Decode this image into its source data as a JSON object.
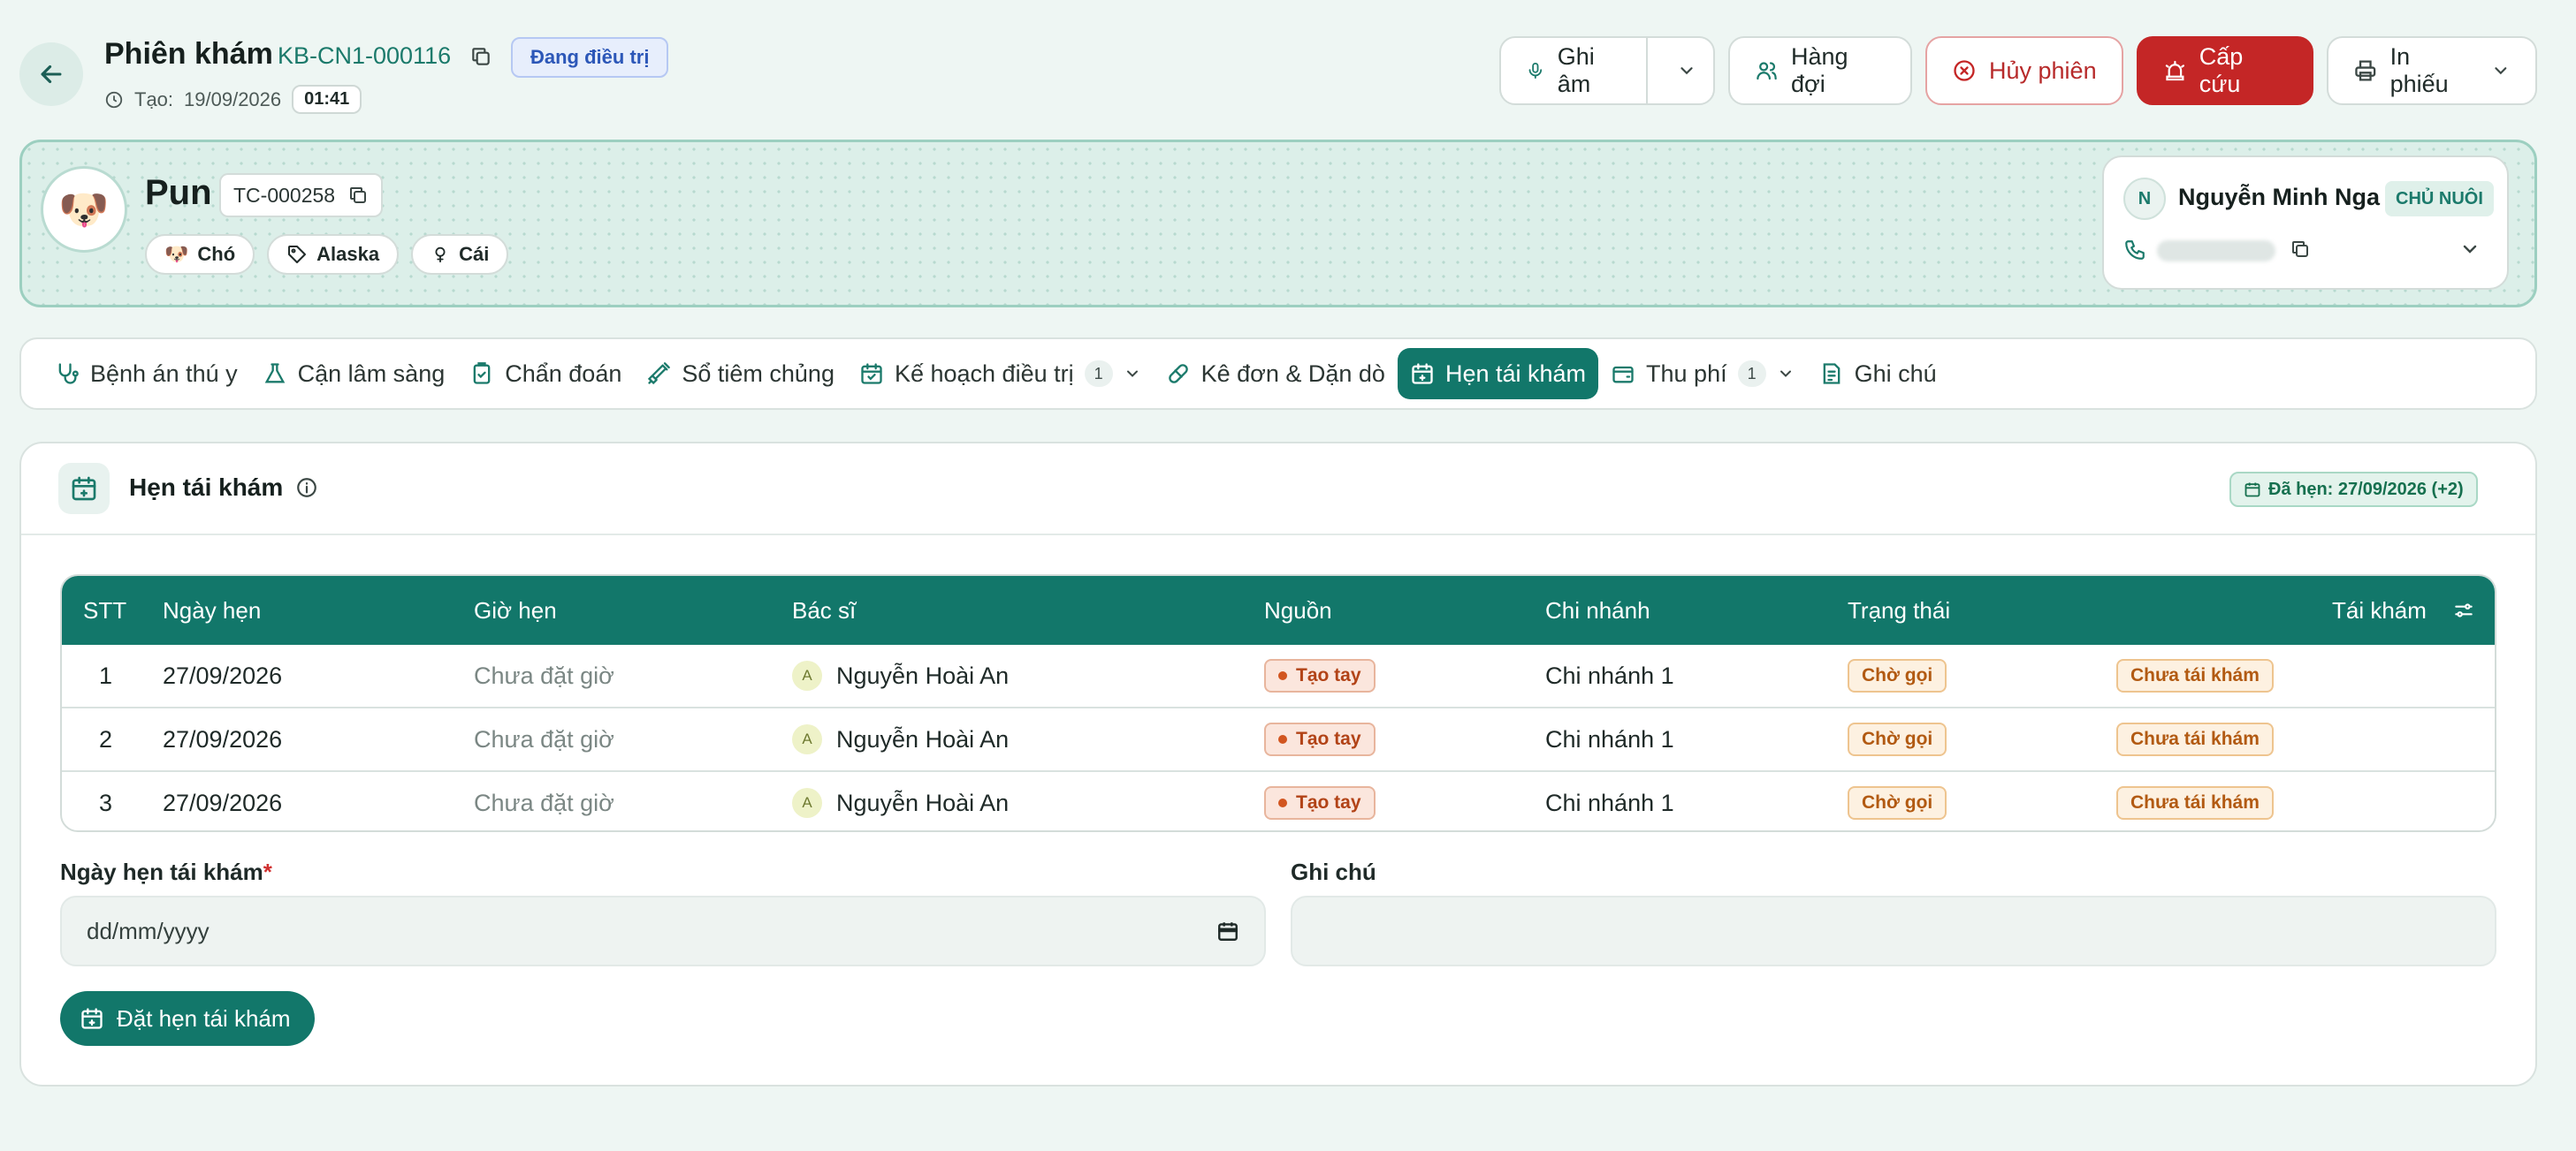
{
  "header": {
    "title": "Phiên khám",
    "session_code": "KB-CN1-000116",
    "status": "Đang điều trị",
    "created_label": "Tạo:",
    "created_date": "19/09/2026",
    "elapsed_time": "01:41",
    "buttons": {
      "record": "Ghi âm",
      "queue": "Hàng đợi",
      "cancel": "Hủy phiên",
      "emergency": "Cấp cứu",
      "print": "In phiếu"
    }
  },
  "patient": {
    "avatar_emoji": "🐶",
    "name": "Pun",
    "code": "TC-000258",
    "species": "Chó",
    "breed": "Alaska",
    "sex": "Cái",
    "owner": {
      "initial": "N",
      "name": "Nguyễn Minh Nga",
      "role": "CHỦ NUÔI"
    }
  },
  "tabs": [
    {
      "label": "Bệnh án thú y",
      "icon": "stethoscope-icon"
    },
    {
      "label": "Cận lâm sàng",
      "icon": "flask-icon"
    },
    {
      "label": "Chẩn đoán",
      "icon": "clipboard-icon"
    },
    {
      "label": "Sổ tiêm chủng",
      "icon": "syringe-icon"
    },
    {
      "label": "Kế hoạch điều trị",
      "icon": "calendar-check-icon",
      "count": "1"
    },
    {
      "label": "Kê đơn & Dặn dò",
      "icon": "pill-icon"
    },
    {
      "label": "Hẹn tái khám",
      "icon": "calendar-icon",
      "active": true
    },
    {
      "label": "Thu phí",
      "icon": "wallet-icon",
      "count": "1"
    },
    {
      "label": "Ghi chú",
      "icon": "note-icon"
    }
  ],
  "section": {
    "title": "Hẹn tái khám",
    "booked_badge": "Đã hẹn: 27/09/2026 (+2)"
  },
  "table": {
    "columns": [
      "STT",
      "Ngày hẹn",
      "Giờ hẹn",
      "Bác sĩ",
      "Nguồn",
      "Chi nhánh",
      "Trạng thái",
      "Tái khám"
    ],
    "rows": [
      {
        "stt": "1",
        "date": "27/09/2026",
        "time": "Chưa đặt giờ",
        "doctor_initial": "A",
        "doctor": "Nguyễn Hoài An",
        "source": "Tạo tay",
        "branch": "Chi nhánh 1",
        "status": "Chờ gọi",
        "revisit": "Chưa tái khám"
      },
      {
        "stt": "2",
        "date": "27/09/2026",
        "time": "Chưa đặt giờ",
        "doctor_initial": "A",
        "doctor": "Nguyễn Hoài An",
        "source": "Tạo tay",
        "branch": "Chi nhánh 1",
        "status": "Chờ gọi",
        "revisit": "Chưa tái khám"
      },
      {
        "stt": "3",
        "date": "27/09/2026",
        "time": "Chưa đặt giờ",
        "doctor_initial": "A",
        "doctor": "Nguyễn Hoài An",
        "source": "Tạo tay",
        "branch": "Chi nhánh 1",
        "status": "Chờ gọi",
        "revisit": "Chưa tái khám"
      }
    ]
  },
  "form": {
    "date_label": "Ngày hẹn tái khám",
    "required_mark": "*",
    "date_placeholder": "dd/mm/yyyy",
    "note_label": "Ghi chú",
    "note_value": "",
    "submit_label": "Đặt hẹn tái khám"
  },
  "colors": {
    "primary": "#12776a",
    "emergency": "#c42626",
    "banner": "#dcefe9",
    "background": "#eef6f3"
  }
}
